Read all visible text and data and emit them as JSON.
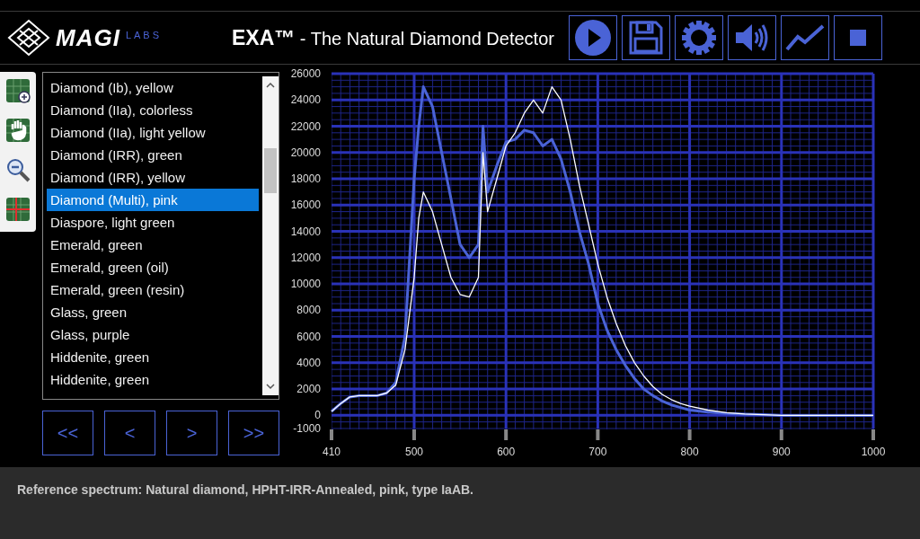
{
  "header": {
    "logo": {
      "brand": "MAGI",
      "sub": "LABS"
    },
    "title": {
      "name": "EXA™",
      "tagline": " - The Natural Diamond Detector"
    },
    "toolbar": [
      {
        "kind": "play"
      },
      {
        "kind": "save"
      },
      {
        "kind": "settings"
      },
      {
        "kind": "volume"
      },
      {
        "kind": "chart"
      },
      {
        "kind": "stop"
      }
    ]
  },
  "tools": [
    {
      "kind": "zoom-box"
    },
    {
      "kind": "pan"
    },
    {
      "kind": "zoom-out"
    },
    {
      "kind": "crosshair"
    }
  ],
  "spectrum_list": {
    "items": [
      {
        "label": "Diamond (Ib), yellow",
        "selected": false
      },
      {
        "label": "Diamond (IIa), colorless",
        "selected": false
      },
      {
        "label": "Diamond (IIa), light yellow",
        "selected": false
      },
      {
        "label": "Diamond (IRR), green",
        "selected": false
      },
      {
        "label": "Diamond (IRR), yellow",
        "selected": false
      },
      {
        "label": "Diamond (Multi), pink",
        "selected": true
      },
      {
        "label": "Diaspore, light green",
        "selected": false
      },
      {
        "label": "Emerald, green",
        "selected": false
      },
      {
        "label": "Emerald, green (oil)",
        "selected": false
      },
      {
        "label": "Emerald, green (resin)",
        "selected": false
      },
      {
        "label": "Glass, green",
        "selected": false
      },
      {
        "label": "Glass, purple",
        "selected": false
      },
      {
        "label": "Hiddenite, green",
        "selected": false
      },
      {
        "label": "Hiddenite, green",
        "selected": false
      }
    ]
  },
  "navigation": [
    "<<",
    "<",
    ">",
    ">>"
  ],
  "chart": {
    "chart_data": {
      "type": "line",
      "x": [
        410,
        420,
        430,
        440,
        450,
        460,
        470,
        480,
        490,
        500,
        505,
        510,
        520,
        530,
        540,
        550,
        560,
        570,
        575,
        580,
        590,
        600,
        610,
        620,
        630,
        640,
        650,
        660,
        670,
        680,
        690,
        700,
        710,
        720,
        730,
        740,
        750,
        760,
        770,
        780,
        790,
        800,
        820,
        840,
        860,
        880,
        900,
        950,
        1000
      ],
      "series": [
        {
          "color": "#4a63d6",
          "values": [
            300,
            900,
            1400,
            1500,
            1500,
            1500,
            1700,
            2500,
            6000,
            18000,
            22000,
            25000,
            23500,
            20000,
            16500,
            13000,
            12000,
            13000,
            22000,
            17000,
            19000,
            20800,
            21000,
            21700,
            21500,
            20500,
            21000,
            19500,
            17000,
            14000,
            11500,
            8500,
            6500,
            5000,
            3800,
            2800,
            2000,
            1500,
            1100,
            800,
            600,
            400,
            250,
            150,
            100,
            50,
            0,
            0,
            0
          ]
        },
        {
          "color": "#ffffff",
          "values": [
            300,
            900,
            1400,
            1500,
            1500,
            1500,
            1700,
            2300,
            5000,
            10500,
            15000,
            17000,
            15500,
            13000,
            10500,
            9200,
            9000,
            10500,
            20000,
            15500,
            18000,
            20500,
            21500,
            23000,
            24000,
            23000,
            25000,
            24000,
            21000,
            17500,
            14500,
            11500,
            9000,
            7000,
            5300,
            4000,
            3000,
            2200,
            1600,
            1200,
            900,
            700,
            400,
            200,
            100,
            50,
            0,
            0,
            0
          ]
        }
      ],
      "grid": true,
      "xlim": [
        410,
        1000
      ],
      "ylim": [
        -1000,
        26000
      ],
      "xticks": [
        410,
        500,
        600,
        700,
        800,
        900,
        1000
      ],
      "yticks": [
        -1000,
        0,
        2000,
        4000,
        6000,
        8000,
        10000,
        12000,
        14000,
        16000,
        18000,
        20000,
        22000,
        24000,
        26000
      ]
    }
  },
  "status_bar": "Reference spectrum: Natural diamond, HPHT-IRR-Annealed, pink, type IaAB."
}
